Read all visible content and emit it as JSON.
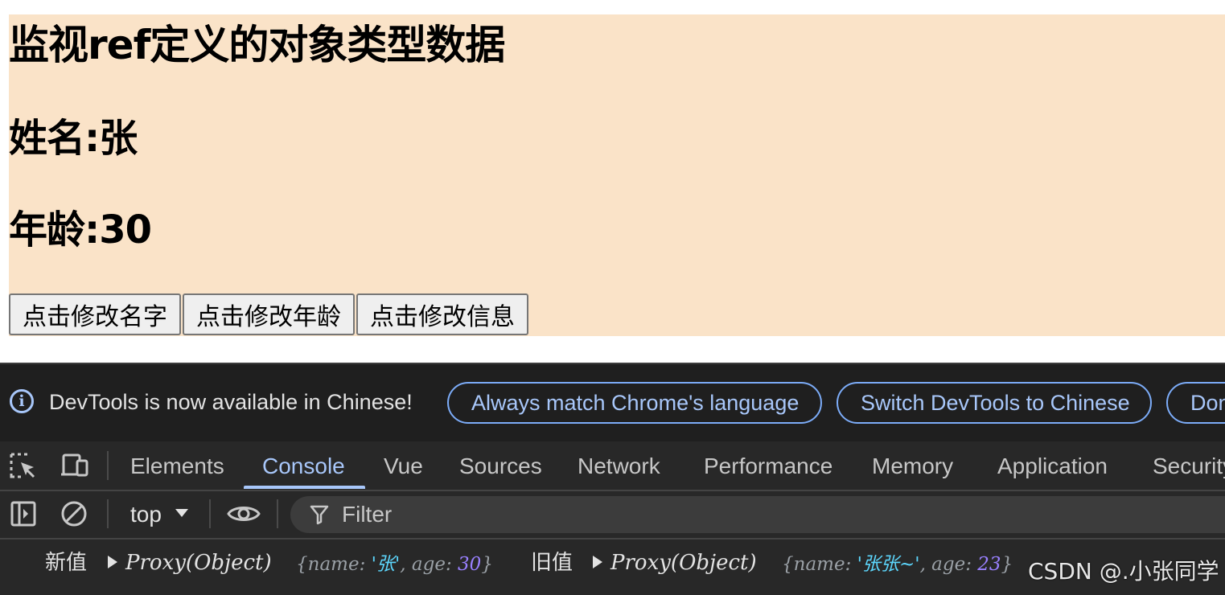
{
  "app": {
    "title": "监视ref定义的对象类型数据",
    "name_line": "姓名:张",
    "age_line": "年龄:30",
    "buttons": [
      "点击修改名字",
      "点击修改年龄",
      "点击修改信息"
    ],
    "background": "#fae3c8"
  },
  "devtools": {
    "infobar": {
      "message": "DevTools is now available in Chinese!",
      "actions": [
        "Always match Chrome's language",
        "Switch DevTools to Chinese",
        "Don"
      ]
    },
    "tabs": [
      "Elements",
      "Console",
      "Vue",
      "Sources",
      "Network",
      "Performance",
      "Memory",
      "Application",
      "Security"
    ],
    "active_tab": "Console",
    "context": "top",
    "filter_placeholder": "Filter",
    "log": {
      "new_label": "新值",
      "new_type": "Proxy(Object)",
      "new_preview_open": "{name: ",
      "new_name": "'张'",
      "new_age_key": ", age: ",
      "new_age": "30",
      "close": "}",
      "old_label": "旧值",
      "old_type": "Proxy(Object)",
      "old_preview_open": "{name: ",
      "old_name": "'张张~'",
      "old_age_key": ", age: ",
      "old_age": "23"
    }
  },
  "watermark": "CSDN @.小张同学"
}
